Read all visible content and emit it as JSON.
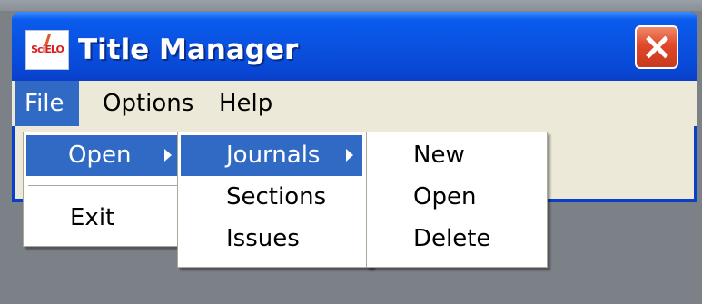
{
  "window": {
    "title": "Title Manager",
    "app_icon_text": "SciELO"
  },
  "menubar": {
    "items": [
      "File",
      "Options",
      "Help"
    ]
  },
  "file_menu": {
    "open_label": "Open",
    "exit_label": "Exit"
  },
  "open_submenu": {
    "items": [
      "Journals",
      "Sections",
      "Issues"
    ]
  },
  "journals_submenu": {
    "items": [
      "New",
      "Open",
      "Delete"
    ]
  },
  "colors": {
    "title_bar": "#0a50df",
    "menu_highlight": "#316ac5",
    "menubar_bg": "#ece9d8",
    "close_button": "#e0482a"
  }
}
